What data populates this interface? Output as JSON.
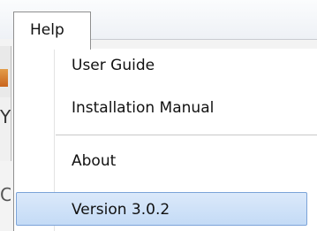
{
  "menu": {
    "header": "Help",
    "items": [
      {
        "label": "User Guide"
      },
      {
        "label": "Installation Manual"
      },
      {
        "label": "About"
      },
      {
        "label": "Version 3.0.2"
      }
    ],
    "highlighted_item": "Version 3.0.2"
  },
  "colors": {
    "highlight_fill": "#cfe2f8",
    "highlight_border": "#7ba3d8",
    "menu_border": "#8f8f8f"
  }
}
